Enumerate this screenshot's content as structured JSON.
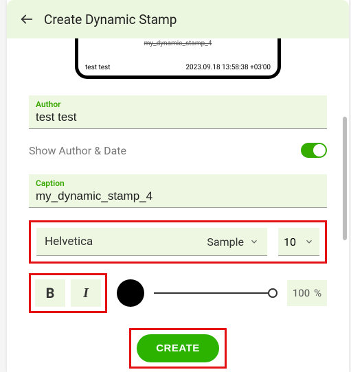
{
  "header": {
    "title": "Create Dynamic Stamp"
  },
  "preview": {
    "top_text": "my_dynamic_stamp_4",
    "author": "test test",
    "timestamp": "2023.09.18 13:58:38 +03'00"
  },
  "author_field": {
    "label": "Author",
    "value": "test test"
  },
  "toggle": {
    "label": "Show Author & Date",
    "on": true
  },
  "caption_field": {
    "label": "Caption",
    "value": "my_dynamic_stamp_4"
  },
  "font": {
    "name": "Helvetica",
    "sample_label": "Sample",
    "size": "10"
  },
  "style": {
    "bold": "B",
    "italic": "I",
    "opacity_value": "100",
    "opacity_unit": "%"
  },
  "create_label": "CREATE"
}
